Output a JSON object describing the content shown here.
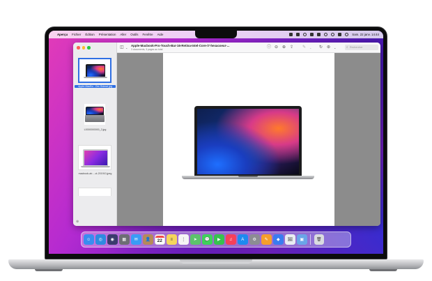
{
  "menubar": {
    "app_name": "Aperçu",
    "menus": [
      "Fichier",
      "Édition",
      "Présentation",
      "Aller",
      "Outils",
      "Fenêtre",
      "Aide"
    ],
    "clock": "Sam. 22 janv.  14:44"
  },
  "window": {
    "title": "Apple-Macbook-Pro-Touch-Bar-16-Retina-Intel-Core-i7-hexacoeur-...",
    "subtitle": "3 documents, 3 pages au total",
    "search_placeholder": "Rechercher"
  },
  "sidebar": {
    "thumbnails": [
      {
        "label": "Apple-MacBo...Ore-Sideral.jpg",
        "selected": true
      },
      {
        "label": "L0000000000_2.jpg",
        "selected": false
      },
      {
        "label": "macbook-air-...ct-201910.jpeg",
        "selected": false
      }
    ]
  },
  "dock": {
    "calendar_date": "22",
    "icons": [
      {
        "name": "finder-icon",
        "color": "#3a8cf0",
        "glyph": "☺"
      },
      {
        "name": "safari-icon",
        "color": "#2f8ae0",
        "glyph": "◎"
      },
      {
        "name": "siri-icon",
        "color": "#3b3b6e",
        "glyph": "◉"
      },
      {
        "name": "launchpad-icon",
        "color": "#6d6d74",
        "glyph": "▦"
      },
      {
        "name": "mail-icon",
        "color": "#3a9cf5",
        "glyph": "✉"
      },
      {
        "name": "contacts-icon",
        "color": "#b58a5a",
        "glyph": "👤"
      },
      {
        "name": "calendar-icon",
        "color": "#ffffff",
        "glyph": ""
      },
      {
        "name": "notes-icon",
        "color": "#f4d65c",
        "glyph": "≡"
      },
      {
        "name": "reminders-icon",
        "color": "#f5f5f5",
        "glyph": "⋮"
      },
      {
        "name": "maps-icon",
        "color": "#5cc36b",
        "glyph": "➤"
      },
      {
        "name": "messages-icon",
        "color": "#3fd15b",
        "glyph": "💬"
      },
      {
        "name": "facetime-icon",
        "color": "#37c24f",
        "glyph": "▶"
      },
      {
        "name": "music-icon",
        "color": "#f6405a",
        "glyph": "♫"
      },
      {
        "name": "app-store-icon",
        "color": "#1e8af0",
        "glyph": "A"
      },
      {
        "name": "system-preferences-icon",
        "color": "#8c8c93",
        "glyph": "⚙"
      },
      {
        "name": "pages-icon",
        "color": "#f59e2b",
        "glyph": "✎"
      },
      {
        "name": "keynote-icon",
        "color": "#3a7cf0",
        "glyph": "◆"
      },
      {
        "name": "preview-icon",
        "color": "#e9edf2",
        "glyph": "🖼"
      },
      {
        "name": "photos-preview-icon",
        "color": "#6aa5e8",
        "glyph": "▣"
      }
    ],
    "trash": {
      "name": "trash-icon",
      "color": "#d9dbe0",
      "glyph": "🗑"
    }
  },
  "colors": {
    "selection": "#2f6fe3",
    "canvas": "#8c8c8c"
  }
}
